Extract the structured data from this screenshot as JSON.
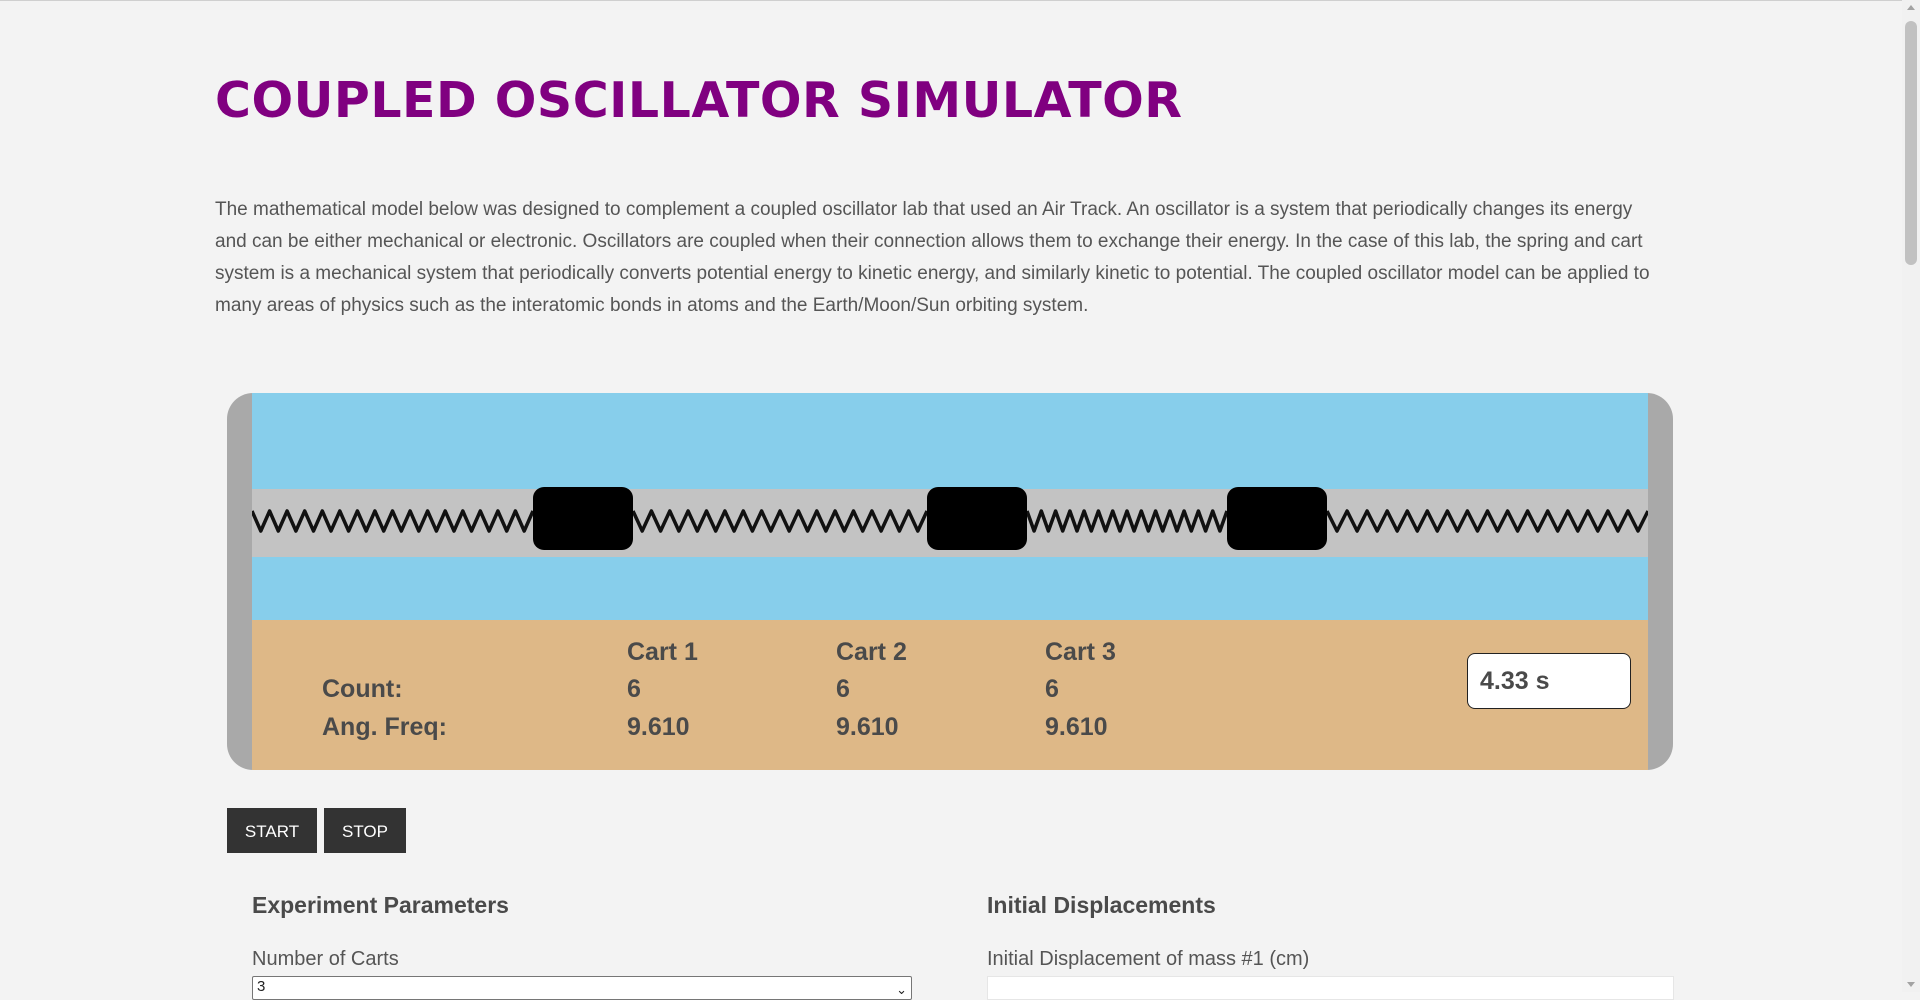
{
  "header": {
    "title": "COUPLED OSCILLATOR SIMULATOR"
  },
  "intro": {
    "text": "The mathematical model below was designed to complement a coupled oscillator lab that used an Air Track. An oscillator is a system that periodically changes its energy and can be either mechanical or electronic. Oscillators are coupled when their connection allows them to exchange their energy. In the case of this lab, the spring and cart system is a mechanical system that periodically converts potential energy to kinetic energy, and similarly kinetic to potential. The coupled oscillator model can be applied to many areas of physics such as the interatomic bonds in atoms and the Earth/Moon/Sun orbiting system."
  },
  "simulation": {
    "colors": {
      "sky": "#87ceeb",
      "track": "#c3c3c3",
      "readout_bg": "#deb887",
      "frame": "#a9a9a9",
      "cart": "#000000",
      "spring": "#111111"
    },
    "readout": {
      "count_label": "Count:",
      "freq_label": "Ang. Freq:",
      "carts": [
        {
          "name": "Cart 1",
          "count": "6",
          "freq": "9.610"
        },
        {
          "name": "Cart 2",
          "count": "6",
          "freq": "9.610"
        },
        {
          "name": "Cart 3",
          "count": "6",
          "freq": "9.610"
        }
      ],
      "timer": "4.33 s"
    }
  },
  "controls": {
    "start_label": "START",
    "stop_label": "STOP"
  },
  "params": {
    "heading": "Experiment Parameters",
    "num_carts_label": "Number of Carts",
    "num_carts_value": "3"
  },
  "displacements": {
    "heading": "Initial Displacements",
    "mass1_label": "Initial Displacement of mass #1 (cm)",
    "mass1_value": ""
  }
}
